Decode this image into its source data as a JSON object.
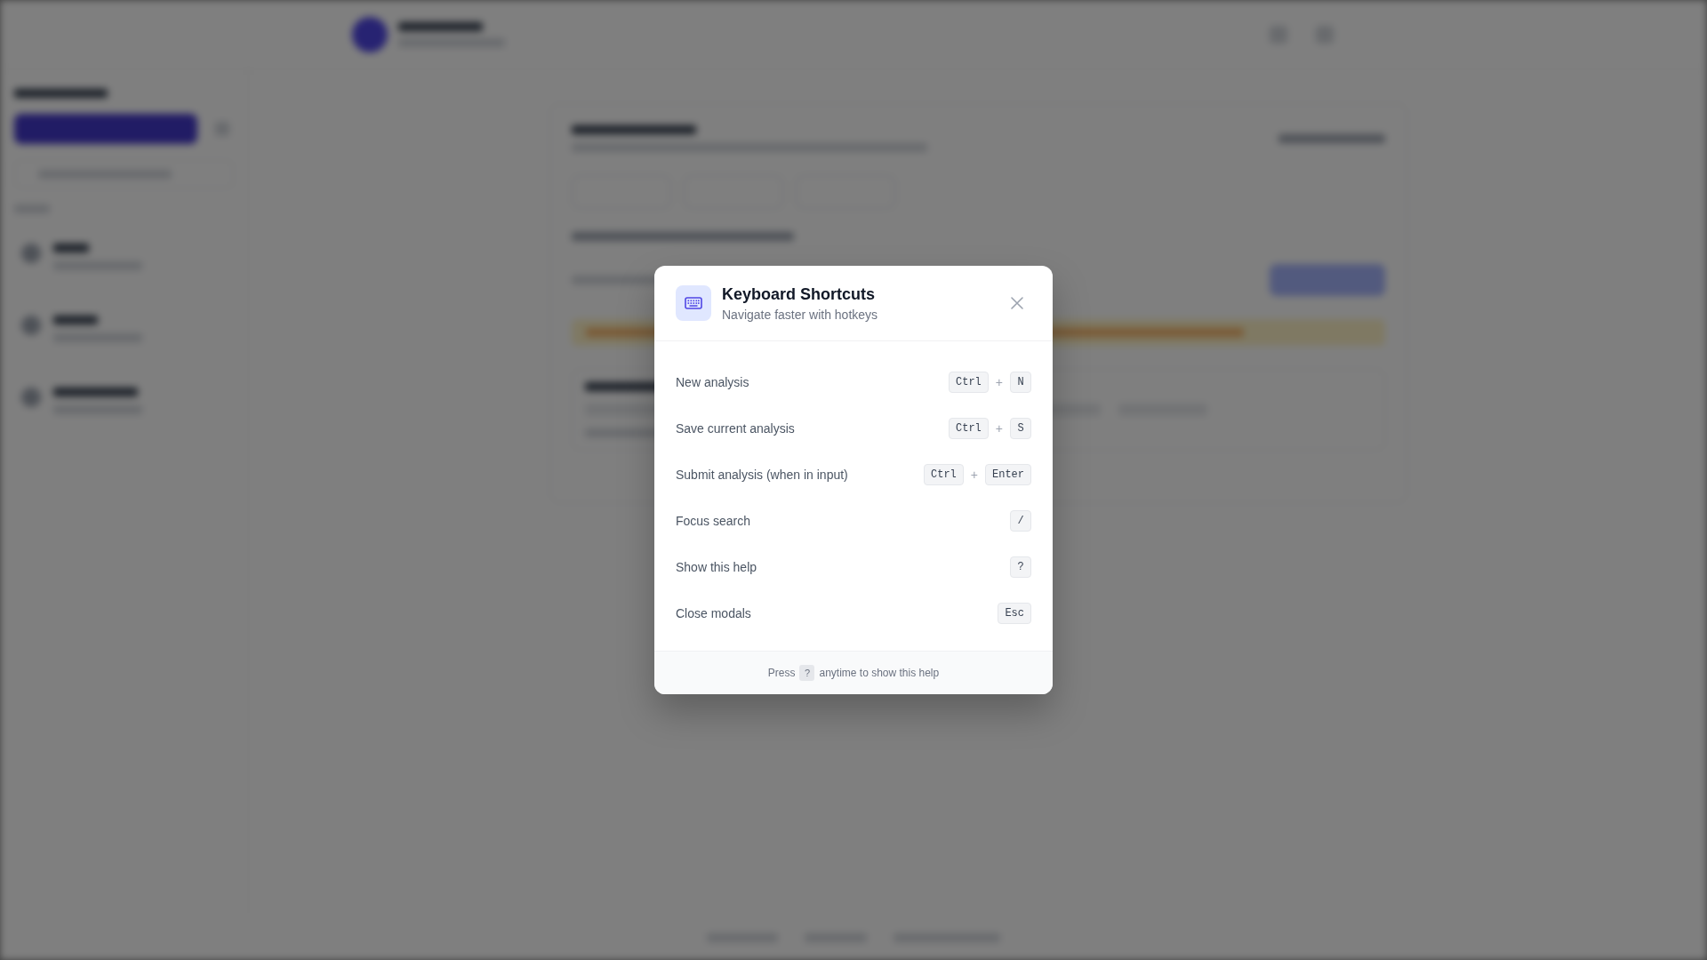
{
  "dialog": {
    "title": "Keyboard Shortcuts",
    "subtitle": "Navigate faster with hotkeys",
    "shortcuts": [
      {
        "action": "New analysis",
        "combo": [
          {
            "kind": "key",
            "text": "Ctrl"
          },
          {
            "kind": "separator",
            "text": "+"
          },
          {
            "kind": "key",
            "text": "N"
          }
        ]
      },
      {
        "action": "Save current analysis",
        "combo": [
          {
            "kind": "key",
            "text": "Ctrl"
          },
          {
            "kind": "separator",
            "text": "+"
          },
          {
            "kind": "key",
            "text": "S"
          }
        ]
      },
      {
        "action": "Submit analysis (when in input)",
        "combo": [
          {
            "kind": "key",
            "text": "Ctrl"
          },
          {
            "kind": "separator",
            "text": "+"
          },
          {
            "kind": "key",
            "text": "Enter"
          }
        ]
      },
      {
        "action": "Focus search",
        "combo": [
          {
            "kind": "key",
            "text": "/"
          }
        ]
      },
      {
        "action": "Show this help",
        "combo": [
          {
            "kind": "key",
            "text": "?"
          }
        ]
      },
      {
        "action": "Close modals",
        "combo": [
          {
            "kind": "key",
            "text": "Esc"
          }
        ]
      }
    ],
    "footer": [
      {
        "kind": "text",
        "text": "Press"
      },
      {
        "kind": "key",
        "text": "?"
      },
      {
        "kind": "text",
        "text": "anytime to show this help"
      }
    ]
  }
}
